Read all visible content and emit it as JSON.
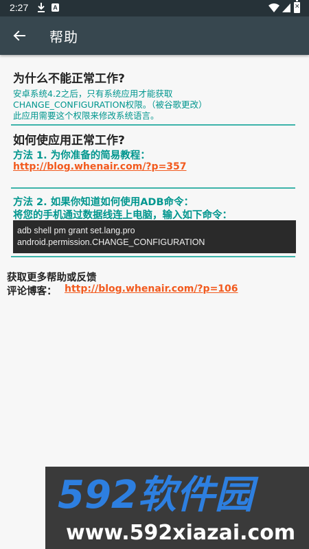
{
  "status": {
    "time": "2:27",
    "a_badge": "A",
    "battery_mark": "✕"
  },
  "appbar": {
    "title": "帮助"
  },
  "section1": {
    "heading": "为什么不能正常工作?",
    "line1": "安卓系统4.2之后，只有系统应用才能获取",
    "line2": "CHANGE_CONFIGURATION权限。（被谷歌更改）",
    "line3": "此应用需要这个权限来修改系统语言。"
  },
  "section2": {
    "heading": "如何使应用正常工作?",
    "method1": "方法 1. 为你准备的简易教程：",
    "method1_link": "http://blog.whenair.com/?p=357",
    "method2_line1": "方法 2. 如果你知道如何使用ADB命令：",
    "method2_line2": "将您的手机通过数据线连上电脑，输入如下命令：",
    "command_line1": "adb shell pm grant set.lang.pro",
    "command_line2": "android.permission.CHANGE_CONFIGURATION"
  },
  "section3": {
    "heading": "获取更多帮助或反馈",
    "blog_label": "评论博客：",
    "blog_link": "http://blog.whenair.com/?p=106"
  },
  "watermark": {
    "brand": "592软件园",
    "url": "www.592xiazai.com"
  },
  "colors": {
    "teal": "#00968e",
    "link": "#f25a1e",
    "appbar": "#37474f",
    "statusbar": "#263238"
  }
}
